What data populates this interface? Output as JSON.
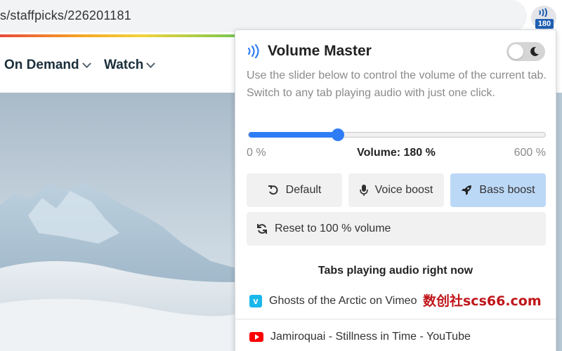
{
  "browser": {
    "url": "s/staffpicks/226201181",
    "extension_badge": "180"
  },
  "page_nav": {
    "items": [
      {
        "label": "On Demand",
        "icon": "chevron-down-icon"
      },
      {
        "label": "Watch",
        "icon": "chevron-down-icon"
      }
    ]
  },
  "popup": {
    "title": "Volume Master",
    "title_icon": "speaker-waves-icon",
    "dark_mode_toggle": {
      "on": false,
      "icon": "moon-icon"
    },
    "description": "Use the slider below to control the volume of the current tab. Switch to any tab playing audio with just one click.",
    "slider": {
      "min_label": "0 %",
      "max_label": "600 %",
      "current_label": "Volume: 180 %",
      "min": 0,
      "max": 600,
      "value": 180
    },
    "presets": [
      {
        "label": "Default",
        "icon": "undo-icon",
        "active": false
      },
      {
        "label": "Voice boost",
        "icon": "microphone-icon",
        "active": false
      },
      {
        "label": "Bass boost",
        "icon": "rocket-icon",
        "active": true
      }
    ],
    "reset": {
      "label": "Reset to 100 % volume",
      "icon": "refresh-icon"
    },
    "tabs_heading": "Tabs playing audio right now",
    "tabs": [
      {
        "title": "Ghosts of the Arctic on Vimeo",
        "icon": "vimeo-icon"
      },
      {
        "title": "Jamiroquai - Stillness in Time - YouTube",
        "icon": "youtube-icon"
      }
    ]
  },
  "watermark": "数创社scs66.com",
  "colors": {
    "accent": "#2f7df6",
    "active_preset": "#bcd8f7",
    "badge": "#1f5fb3",
    "watermark": "#c0161a"
  }
}
